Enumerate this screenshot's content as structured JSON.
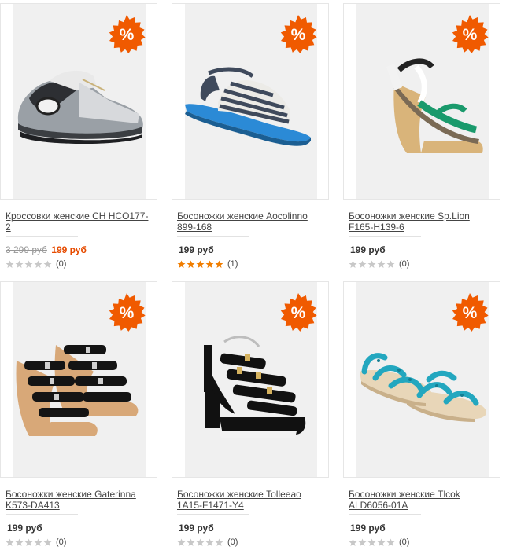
{
  "badge_label": "%",
  "colors": {
    "badge": "#f05a00",
    "accent": "#e64b00",
    "star_on": "#f07d00",
    "star_off": "#c8c8c8"
  },
  "products": [
    {
      "title": "Кроссовки женские CH HCO177-2",
      "old_price": "3 299 руб",
      "price": "199 руб",
      "rating": 0,
      "reviews": "(0)",
      "icon": "sneaker-icon"
    },
    {
      "title": "Босоножки женские Aocolinno 899-168",
      "old_price": "",
      "price": "199 руб",
      "rating": 5,
      "reviews": "(1)",
      "icon": "espadrille-sandal-icon"
    },
    {
      "title": "Босоножки женские Sp.Lion F165-H139-6",
      "old_price": "",
      "price": "199 руб",
      "rating": 0,
      "reviews": "(0)",
      "icon": "wedge-sandal-icon"
    },
    {
      "title": "Босоножки женские Gaterinna K573-DA413",
      "old_price": "",
      "price": "199 руб",
      "rating": 0,
      "reviews": "(0)",
      "icon": "cork-wedge-sandal-icon"
    },
    {
      "title": "Босоножки женские Tolleeao 1A15-F1471-Y4",
      "old_price": "",
      "price": "199 руб",
      "rating": 0,
      "reviews": "(0)",
      "icon": "platform-heel-sandal-icon"
    },
    {
      "title": "Босоножки женские Tlcok ALD6056-01A",
      "old_price": "",
      "price": "199 руб",
      "rating": 0,
      "reviews": "(0)",
      "icon": "flat-sandal-icon"
    }
  ]
}
